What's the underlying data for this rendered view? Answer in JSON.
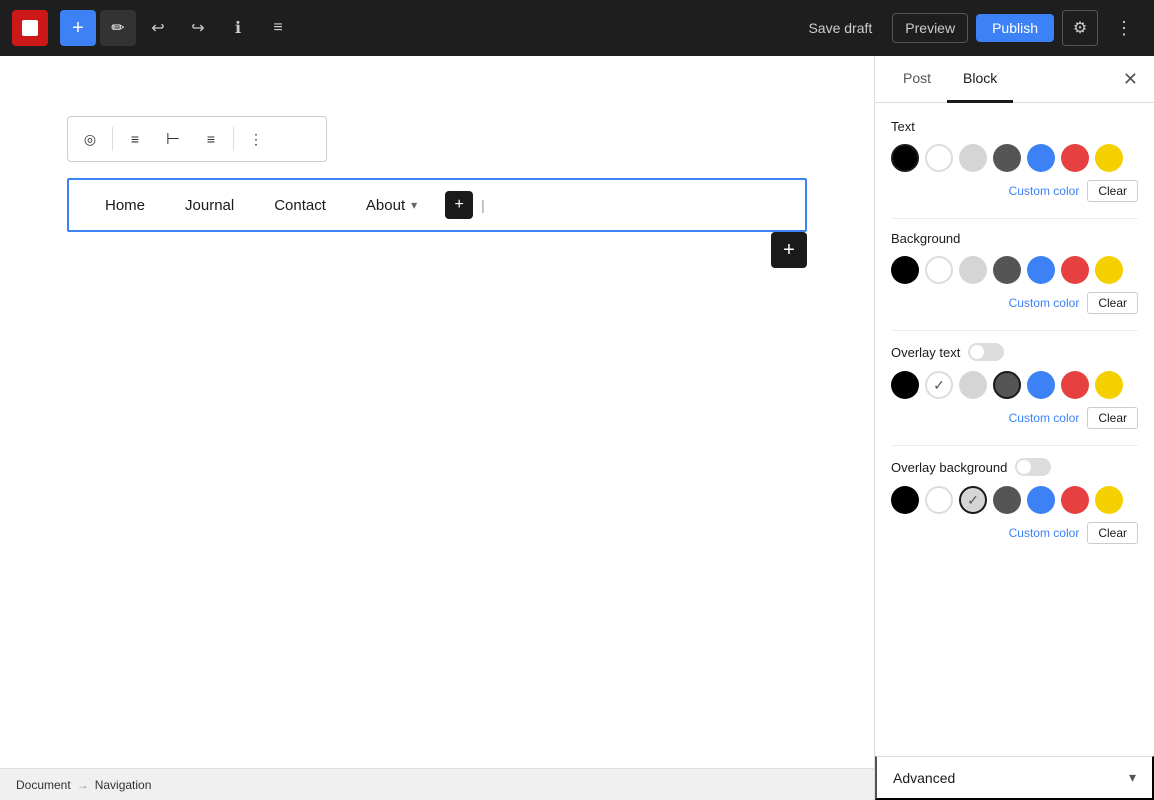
{
  "toolbar": {
    "add_button_label": "+",
    "save_draft_label": "Save draft",
    "preview_label": "Preview",
    "publish_label": "Publish",
    "undo_icon": "↩",
    "redo_icon": "↪",
    "info_icon": "ℹ",
    "list_icon": "≡",
    "settings_icon": "⚙",
    "more_icon": "⋮",
    "edit_icon": "✏"
  },
  "block_toolbar": {
    "icon1": "◎",
    "icon2": "≡",
    "icon3": "⊢",
    "icon4": "≡",
    "icon5": "⋮"
  },
  "nav": {
    "items": [
      "Home",
      "Journal",
      "Contact",
      "About"
    ],
    "about_has_dropdown": true,
    "add_icon": "+"
  },
  "sidebar": {
    "tab_post": "Post",
    "tab_block": "Block",
    "close_icon": "✕",
    "sections": {
      "text_label": "Text",
      "background_label": "Background",
      "overlay_text_label": "Overlay text",
      "overlay_background_label": "Overlay background",
      "advanced_label": "Advanced"
    },
    "colors": {
      "black": "#000000",
      "white": "#ffffff",
      "light_gray": "#d5d5d5",
      "dark_gray": "#555555",
      "blue": "#3c82f6",
      "red": "#e74040",
      "yellow": "#f5d000"
    },
    "text_selected": "black",
    "overlay_text_selected": "dark_gray",
    "overlay_bg_selected": "light_gray",
    "custom_color_label": "Custom color",
    "clear_label": "Clear"
  },
  "breadcrumb": {
    "items": [
      "Document",
      "Navigation"
    ],
    "separator": "→"
  },
  "add_block_icon": "+"
}
